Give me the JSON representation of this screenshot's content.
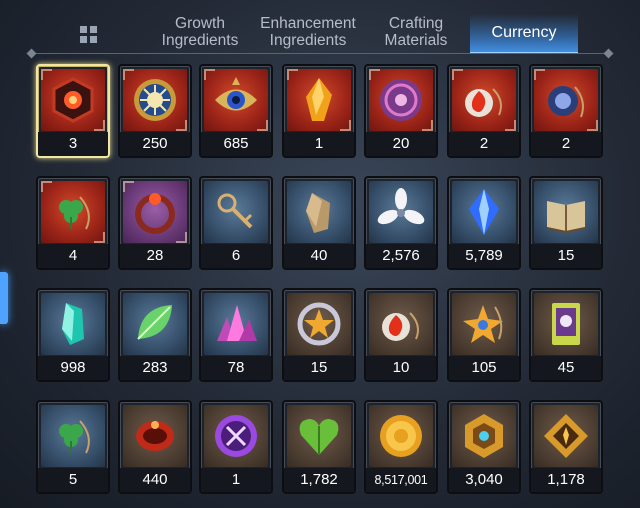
{
  "tabs": [
    {
      "label": "Growth\nIngredients",
      "active": false
    },
    {
      "label": "Enhancement\nIngredients",
      "active": false
    },
    {
      "label": "Crafting\nMaterials",
      "active": false
    },
    {
      "label": "Currency",
      "active": true
    }
  ],
  "items": [
    {
      "icon": "red-flower-crest-icon",
      "bg": "red",
      "count": "3",
      "selected": true
    },
    {
      "icon": "sun-medallion-icon",
      "bg": "red",
      "count": "250"
    },
    {
      "icon": "golden-eye-emblem-icon",
      "bg": "red",
      "count": "685"
    },
    {
      "icon": "amber-crystal-icon",
      "bg": "red",
      "count": "1"
    },
    {
      "icon": "purple-shield-coin-icon",
      "bg": "red",
      "count": "20"
    },
    {
      "icon": "flame-pendant-icon",
      "bg": "red",
      "count": "2"
    },
    {
      "icon": "blue-ring-pendant-icon",
      "bg": "red",
      "count": "2"
    },
    {
      "icon": "clover-pendant-icon",
      "bg": "red",
      "count": "4"
    },
    {
      "icon": "flower-bracelet-icon",
      "bg": "purple",
      "count": "28"
    },
    {
      "icon": "ornate-key-icon",
      "bg": "blue",
      "count": "6"
    },
    {
      "icon": "stone-shard-icon",
      "bg": "blue",
      "count": "40"
    },
    {
      "icon": "white-lily-icon",
      "bg": "blue",
      "count": "2,576"
    },
    {
      "icon": "blue-gem-icon",
      "bg": "blue",
      "count": "5,789"
    },
    {
      "icon": "open-book-icon",
      "bg": "blue",
      "count": "15"
    },
    {
      "icon": "teal-crystal-icon",
      "bg": "blue",
      "count": "998"
    },
    {
      "icon": "green-leaf-icon",
      "bg": "blue",
      "count": "283"
    },
    {
      "icon": "pink-crystal-cluster-icon",
      "bg": "blue",
      "count": "78"
    },
    {
      "icon": "star-ring-icon",
      "bg": "brown",
      "count": "15"
    },
    {
      "icon": "flame-pendant-icon",
      "bg": "brown",
      "count": "10"
    },
    {
      "icon": "star-pendant-icon",
      "bg": "brown",
      "count": "105"
    },
    {
      "icon": "character-card-icon",
      "bg": "brown",
      "count": "45"
    },
    {
      "icon": "clover-pendant-icon",
      "bg": "blue",
      "count": "5"
    },
    {
      "icon": "red-rune-bracelet-icon",
      "bg": "brown",
      "count": "440"
    },
    {
      "icon": "purple-seal-icon",
      "bg": "brown",
      "count": "1"
    },
    {
      "icon": "green-heart-icon",
      "bg": "brown",
      "count": "1,782"
    },
    {
      "icon": "gold-coin-icon",
      "bg": "brown",
      "count": "8,517,001"
    },
    {
      "icon": "gold-hex-emblem-icon",
      "bg": "brown",
      "count": "3,040"
    },
    {
      "icon": "gold-crest-emblem-icon",
      "bg": "brown",
      "count": "1,178"
    }
  ]
}
